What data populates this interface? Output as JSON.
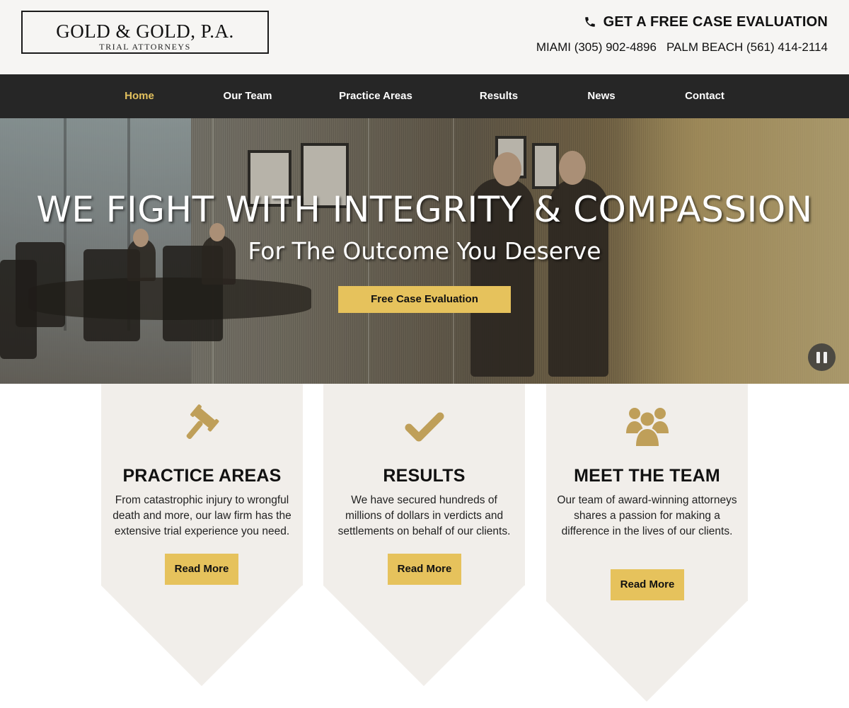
{
  "header": {
    "logo_main": "GOLD & GOLD, P.A.",
    "logo_sub": "TRIAL ATTORNEYS",
    "cta_label": "GET A FREE CASE EVALUATION",
    "phones": {
      "miami": "MIAMI (305) 902-4896",
      "palm_beach": "PALM BEACH (561) 414-2114"
    }
  },
  "nav": {
    "items": [
      {
        "label": "Home",
        "active": true
      },
      {
        "label": "Our Team"
      },
      {
        "label": "Practice Areas"
      },
      {
        "label": "Results"
      },
      {
        "label": "News"
      },
      {
        "label": "Contact"
      }
    ]
  },
  "hero": {
    "title": "WE FIGHT WITH INTEGRITY & COMPASSION",
    "subtitle": "For The Outcome You Deserve",
    "cta_label": "Free Case Evaluation"
  },
  "cards": [
    {
      "icon": "gavel-icon",
      "title": "PRACTICE AREAS",
      "text": "From catastrophic injury to wrongful death and more, our law firm has the extensive trial experience you need.",
      "button": "Read More"
    },
    {
      "icon": "checkmark-icon",
      "title": "RESULTS",
      "text": "We have secured hundreds of millions of dollars in verdicts and settlements on behalf of our clients.",
      "button": "Read More"
    },
    {
      "icon": "team-icon",
      "title": "MEET THE TEAM",
      "text": "Our team of award-winning attorneys shares a passion for making a difference in the lives of our clients.",
      "button": "Read More"
    }
  ],
  "colors": {
    "accent": "#e6c25c",
    "nav_bg": "#262626",
    "nav_active": "#e3c15e",
    "icon_gold": "#bf9f59",
    "card_bg": "#f1eeea",
    "header_bg": "#f6f5f3"
  }
}
